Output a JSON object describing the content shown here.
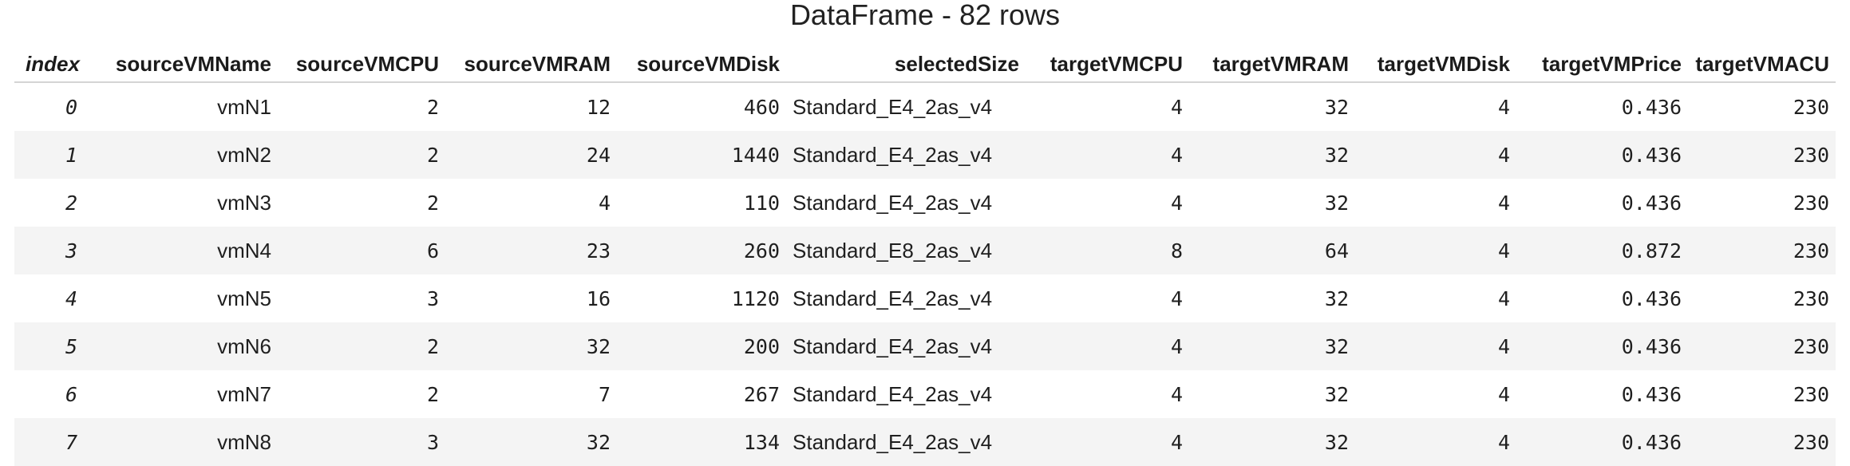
{
  "title": "DataFrame - 82 rows",
  "columns": [
    "index",
    "sourceVMName",
    "sourceVMCPU",
    "sourceVMRAM",
    "sourceVMDisk",
    "selectedSize",
    "targetVMCPU",
    "targetVMRAM",
    "targetVMDisk",
    "targetVMPrice",
    "targetVMACU"
  ],
  "rows": [
    [
      "0",
      "vmN1",
      "2",
      "12",
      "460",
      "Standard_E4_2as_v4",
      "4",
      "32",
      "4",
      "0.436",
      "230"
    ],
    [
      "1",
      "vmN2",
      "2",
      "24",
      "1440",
      "Standard_E4_2as_v4",
      "4",
      "32",
      "4",
      "0.436",
      "230"
    ],
    [
      "2",
      "vmN3",
      "2",
      "4",
      "110",
      "Standard_E4_2as_v4",
      "4",
      "32",
      "4",
      "0.436",
      "230"
    ],
    [
      "3",
      "vmN4",
      "6",
      "23",
      "260",
      "Standard_E8_2as_v4",
      "8",
      "64",
      "4",
      "0.872",
      "230"
    ],
    [
      "4",
      "vmN5",
      "3",
      "16",
      "1120",
      "Standard_E4_2as_v4",
      "4",
      "32",
      "4",
      "0.436",
      "230"
    ],
    [
      "5",
      "vmN6",
      "2",
      "32",
      "200",
      "Standard_E4_2as_v4",
      "4",
      "32",
      "4",
      "0.436",
      "230"
    ],
    [
      "6",
      "vmN7",
      "2",
      "7",
      "267",
      "Standard_E4_2as_v4",
      "4",
      "32",
      "4",
      "0.436",
      "230"
    ],
    [
      "7",
      "vmN8",
      "3",
      "32",
      "134",
      "Standard_E4_2as_v4",
      "4",
      "32",
      "4",
      "0.436",
      "230"
    ]
  ]
}
